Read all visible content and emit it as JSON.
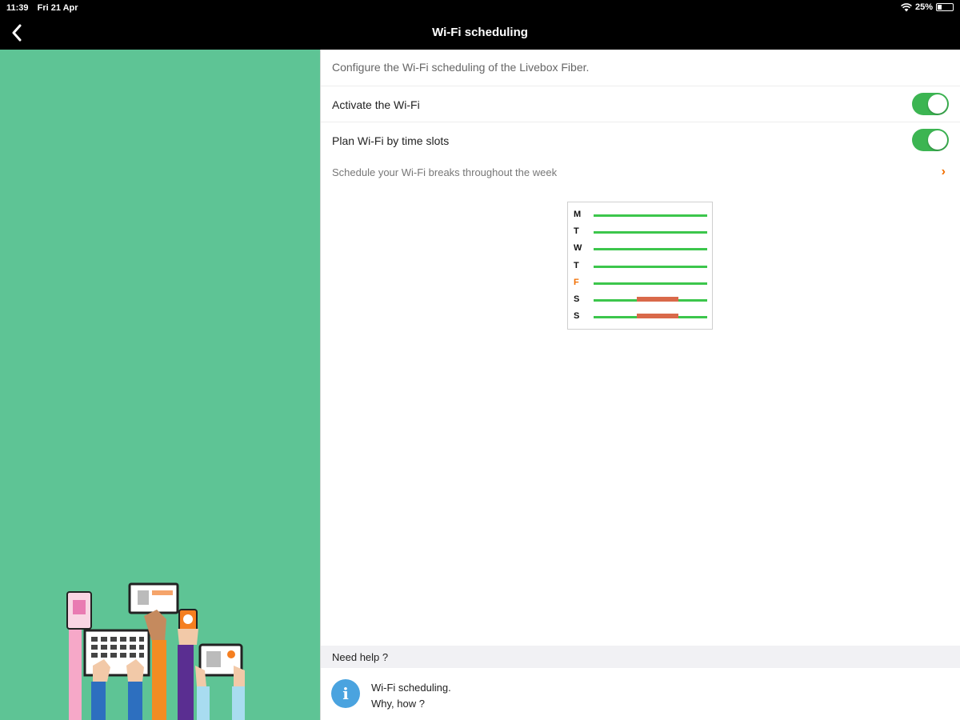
{
  "status": {
    "time": "11:39",
    "date": "Fri 21 Apr",
    "battery": "25%"
  },
  "nav": {
    "title": "Wi-Fi scheduling"
  },
  "main": {
    "intro": "Configure the Wi-Fi scheduling of the Livebox Fiber.",
    "activate_label": "Activate the Wi-Fi",
    "activate_on": true,
    "plan_label": "Plan Wi-Fi by time slots",
    "plan_on": true,
    "schedule_link": "Schedule your Wi-Fi breaks throughout the week"
  },
  "schedule": {
    "days": [
      "M",
      "T",
      "W",
      "T",
      "F",
      "S",
      "S"
    ],
    "today_index": 4,
    "break_days": [
      5,
      6
    ]
  },
  "help": {
    "header": "Need help ?",
    "item_line1": "Wi-Fi scheduling.",
    "item_line2": "Why, how ?"
  },
  "colors": {
    "accent": "#f16e00",
    "toggle_on": "#3cb552",
    "panel_green": "#5ec495",
    "wifi_on": "#3cc64c",
    "wifi_off": "#d9694a"
  }
}
